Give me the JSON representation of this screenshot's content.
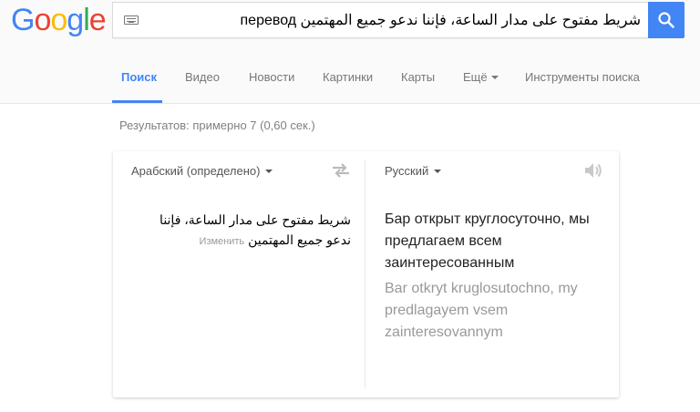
{
  "logo": {
    "letters": [
      "G",
      "o",
      "o",
      "g",
      "l",
      "e"
    ],
    "colors": [
      "#4285f4",
      "#ea4335",
      "#fbbc05",
      "#4285f4",
      "#34a853",
      "#ea4335"
    ]
  },
  "search": {
    "query": "перевод شريط مفتوح على مدار الساعة، فإننا ندعو جميع المهتمين",
    "keyboard_icon": "keyboard-icon",
    "button_icon": "search-icon"
  },
  "tabs": [
    {
      "label": "Поиск",
      "active": true
    },
    {
      "label": "Видео"
    },
    {
      "label": "Новости"
    },
    {
      "label": "Картинки"
    },
    {
      "label": "Карты"
    },
    {
      "label": "Ещё"
    },
    {
      "label": "Инструменты поиска"
    }
  ],
  "stats": "Результатов: примерно 7 (0,60 сек.)",
  "translator": {
    "source_lang": "Арабский (определено)",
    "target_lang": "Русский",
    "source_text": "شريط مفتوح على مدار الساعة، فإننا ندعو جميع المهتمين",
    "edit_label": "Изменить",
    "translation": "Бар открыт круглосуточно, мы предлагаем всем заинтересованным",
    "transliteration": "Bar otkryt kruglosutochno, my predlagayem vsem zainteresovannym"
  },
  "colors": {
    "accent": "#4285f4"
  }
}
